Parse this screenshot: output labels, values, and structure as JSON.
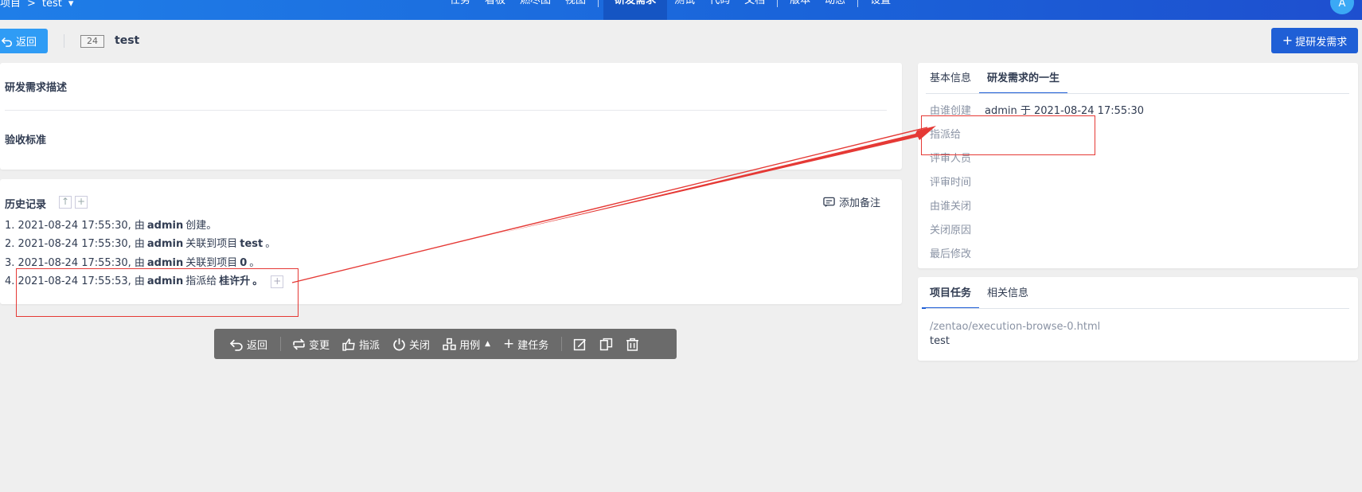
{
  "topbar": {
    "crumb_project": "项目",
    "crumb_sep": ">",
    "crumb_current": "test",
    "nav": [
      "任务",
      "看板",
      "燃尽图",
      "视图",
      "研发需求",
      "测试",
      "代码",
      "文档",
      "版本",
      "动态",
      "设置"
    ],
    "active_nav": "研发需求",
    "avatar_letter": "A",
    "accent": "#1a63d9"
  },
  "header": {
    "back_label": "返回",
    "story_id": "24",
    "story_title": "test",
    "propose_label": "提研发需求"
  },
  "description": {
    "desc_title": "研发需求描述",
    "accept_title": "验收标准"
  },
  "history": {
    "title": "历史记录",
    "add_note": "添加备注",
    "entries": [
      {
        "num": "1.",
        "time": "2021-08-24 17:55:30, 由",
        "user": "admin",
        "action": "创建。",
        "target": "",
        "tail": ""
      },
      {
        "num": "2.",
        "time": "2021-08-24 17:55:30, 由",
        "user": "admin",
        "action": "关联到项目",
        "target": "test",
        "tail": "。"
      },
      {
        "num": "3.",
        "time": "2021-08-24 17:55:30, 由",
        "user": "admin",
        "action": "关联到项目",
        "target": "0",
        "tail": "。"
      },
      {
        "num": "4.",
        "time": "2021-08-24 17:55:53, 由",
        "user": "admin",
        "action": "指派给",
        "target": "桂许升",
        "tail": "。"
      }
    ]
  },
  "toolbar": {
    "back": "返回",
    "change": "变更",
    "assign": "指派",
    "close": "关闭",
    "cases": "用例",
    "build_task": "建任务"
  },
  "life": {
    "tab_basic": "基本信息",
    "tab_life": "研发需求的一生",
    "rows": [
      {
        "k": "由谁创建",
        "v": "admin 于 2021-08-24 17:55:30"
      },
      {
        "k": "指派给",
        "v": ""
      },
      {
        "k": "评审人员",
        "v": ""
      },
      {
        "k": "评审时间",
        "v": ""
      },
      {
        "k": "由谁关闭",
        "v": ""
      },
      {
        "k": "关闭原因",
        "v": ""
      },
      {
        "k": "最后修改",
        "v": ""
      }
    ]
  },
  "tasks": {
    "tab_tasks": "项目任务",
    "tab_related": "相关信息",
    "link": "/zentao/execution-browse-0.html",
    "name": "test"
  },
  "annotation_color": "#e53935"
}
